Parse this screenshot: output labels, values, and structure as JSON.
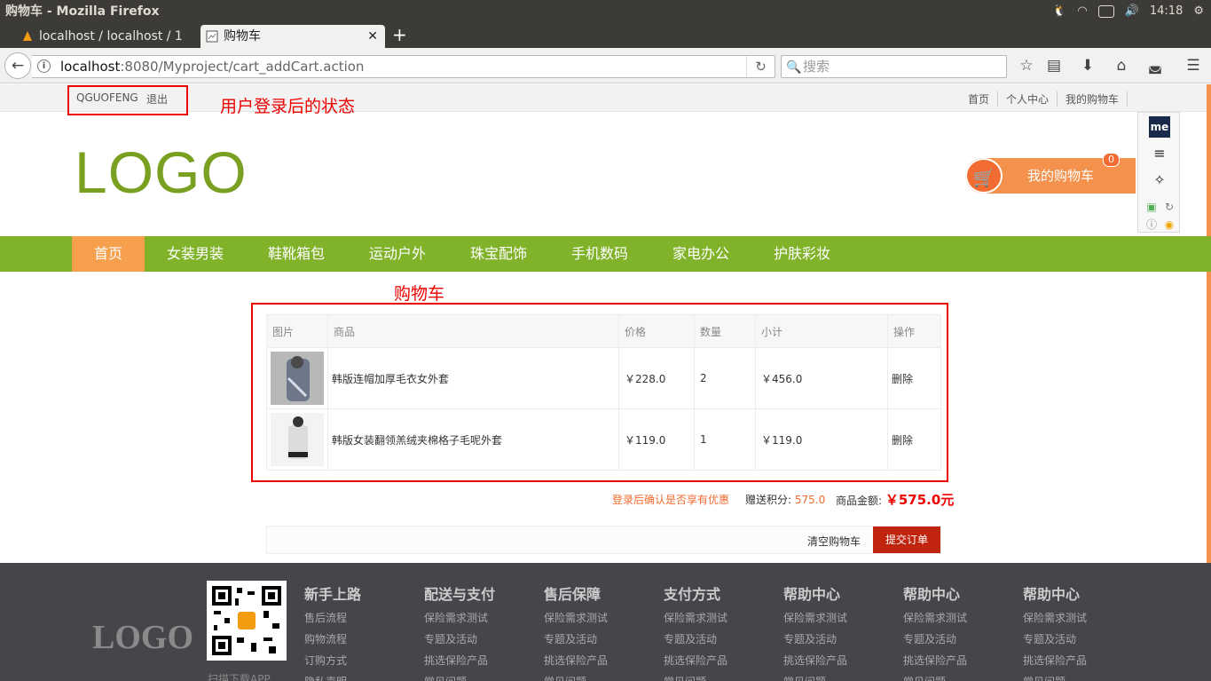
{
  "os": {
    "window_title": "购物车 - Mozilla Firefox",
    "clock": "14:18"
  },
  "browser": {
    "tabs": [
      {
        "label": "localhost / localhost / 1"
      },
      {
        "label": "购物车"
      }
    ],
    "url_host": "localhost",
    "url_rest": ":8080/Myproject/cart_addCart.action",
    "search_placeholder": "搜索"
  },
  "topbar": {
    "username": "QGUOFENG",
    "logout": "退出",
    "links": [
      "首页",
      "个人中心",
      "我的购物车"
    ]
  },
  "annotations": {
    "login_state": "用户登录后的状态",
    "cart_title": "购物车"
  },
  "header": {
    "logo": "LOGO",
    "cart_button": "我的购物车",
    "cart_count": "0",
    "cart_arrow": "›"
  },
  "menu": {
    "items": [
      "首页",
      "女装男装",
      "鞋靴箱包",
      "运动户外",
      "珠宝配饰",
      "手机数码",
      "家电办公",
      "护肤彩妆"
    ]
  },
  "cart": {
    "headers": [
      "图片",
      "商品",
      "价格",
      "数量",
      "小计",
      "操作"
    ],
    "rows": [
      {
        "name": "韩版连帽加厚毛衣女外套",
        "price": "￥228.0",
        "qty": "2",
        "subtotal": "￥456.0",
        "action": "删除"
      },
      {
        "name": "韩版女装翻领羔绒夹棉格子毛呢外套",
        "price": "￥119.0",
        "qty": "1",
        "subtotal": "￥119.0",
        "action": "删除"
      }
    ],
    "promo": "登录后确认是否享有优惠",
    "points_label": "赠送积分:",
    "points_value": "575.0",
    "total_label": "商品金额:",
    "total_value": "￥575.0元",
    "clear": "清空购物车",
    "submit": "提交订单"
  },
  "footer": {
    "logo": "LOGO",
    "qr_caption": "扫描下载APP",
    "columns": [
      {
        "title": "新手上路",
        "links": [
          "售后流程",
          "购物流程",
          "订购方式",
          "隐私声明"
        ]
      },
      {
        "title": "配送与支付",
        "links": [
          "保险需求测试",
          "专题及活动",
          "挑选保险产品",
          "常见问题"
        ]
      },
      {
        "title": "售后保障",
        "links": [
          "保险需求测试",
          "专题及活动",
          "挑选保险产品",
          "常见问题"
        ]
      },
      {
        "title": "支付方式",
        "links": [
          "保险需求测试",
          "专题及活动",
          "挑选保险产品",
          "常见问题"
        ]
      },
      {
        "title": "帮助中心",
        "links": [
          "保险需求测试",
          "专题及活动",
          "挑选保险产品",
          "常见问题"
        ]
      },
      {
        "title": "帮助中心",
        "links": [
          "保险需求测试",
          "专题及活动",
          "挑选保险产品",
          "常见问题"
        ]
      },
      {
        "title": "帮助中心",
        "links": [
          "保险需求测试",
          "专题及活动",
          "挑选保险产品",
          "常见问题"
        ]
      }
    ]
  },
  "colors": {
    "brand_green": "#80b22a",
    "accent_orange": "#f4914c",
    "annotation_red": "#ee0000",
    "submit_red": "#c0230e"
  }
}
